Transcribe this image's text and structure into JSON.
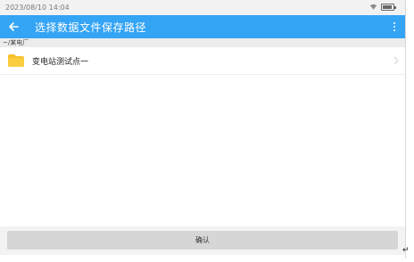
{
  "status_bar": {
    "datetime": "2023/08/10 14:04"
  },
  "app_bar": {
    "title": "选择数据文件保存路径"
  },
  "path": "~/某电厂",
  "items": [
    {
      "label": "变电站测试点一",
      "icon": "folder-icon"
    }
  ],
  "confirm_button": {
    "label": "确认"
  },
  "colors": {
    "accent": "#34a4f5",
    "folder": "#f7c12f",
    "button": "#d6d6d6"
  }
}
